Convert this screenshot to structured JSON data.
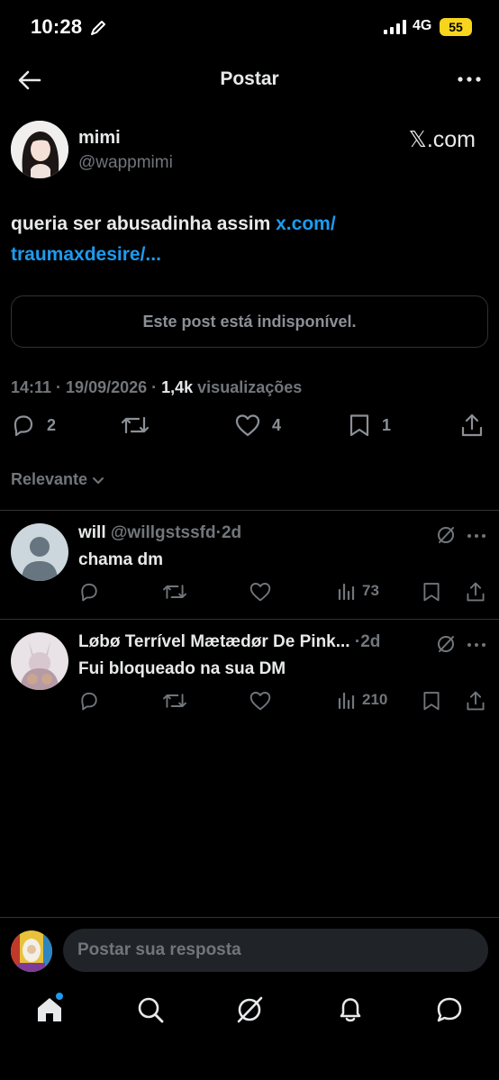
{
  "status_bar": {
    "time": "10:28",
    "network": "4G",
    "battery": "55"
  },
  "header": {
    "title": "Postar"
  },
  "post": {
    "author_name": "mimi",
    "author_handle": "@wappmimi",
    "brand": "𝕏.com",
    "text": "queria ser abusadinha assim ",
    "link_line1": "x.com/",
    "link_line2": "traumaxdesire/...",
    "unavailable": "Este post está indisponível.",
    "timestamp": "14:11 · 19/09/2026 · ",
    "views_count": "1,4k",
    "views_label": " visualizações",
    "replies": "2",
    "likes": "4",
    "bookmarks": "1"
  },
  "sort": {
    "label": "Relevante"
  },
  "replies": [
    {
      "name": "will",
      "handle": "@willgstssfd",
      "dot": "·",
      "time": "2d",
      "text": "chama dm",
      "views": "73"
    },
    {
      "name": "Løbø Terrível Mætædør De Pink...",
      "handle": "",
      "dot": "·",
      "time": "2d",
      "text": "Fui bloqueado na sua DM",
      "views": "210"
    }
  ],
  "compose": {
    "placeholder": "Postar sua resposta"
  },
  "colors": {
    "accent": "#1d9bf0",
    "background": "#000000",
    "muted": "#71767b",
    "battery": "#f7d51c"
  }
}
